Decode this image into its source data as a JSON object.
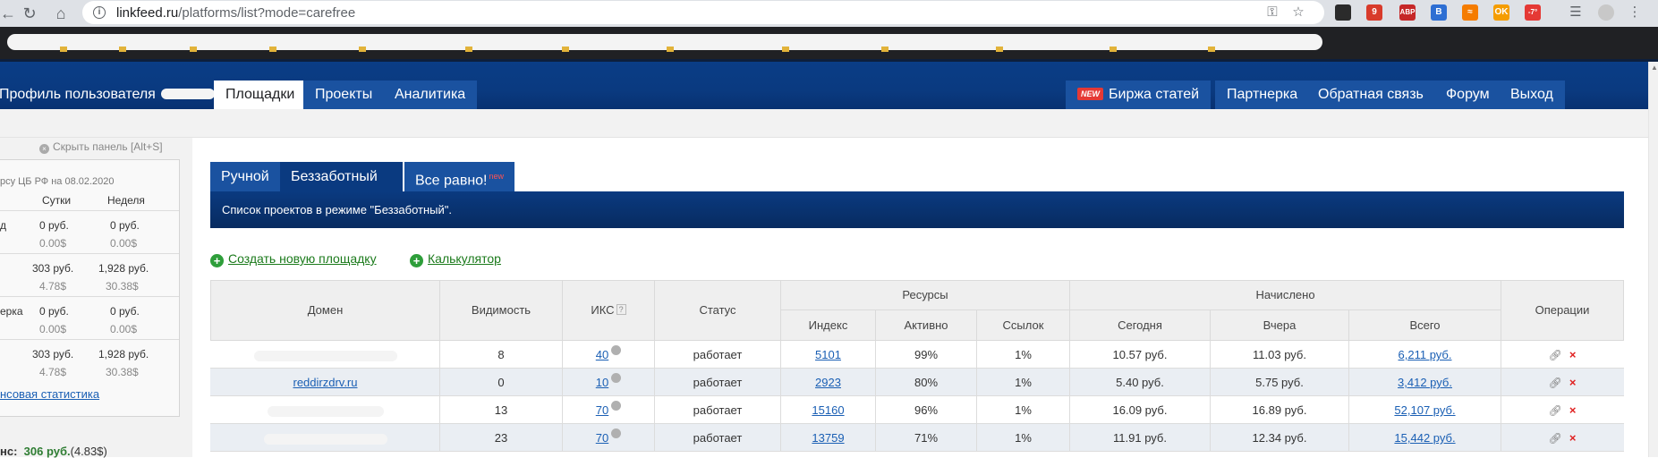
{
  "browser": {
    "url_host": "linkfeed.ru",
    "url_path": "/platforms/list?mode=carefree",
    "back_icon": "arrow-left-icon",
    "reload_icon": "reload-icon",
    "home_icon": "home-icon",
    "key_icon": "key-icon",
    "star_icon": "star-icon",
    "extensions": [
      {
        "label": "",
        "color": "#2b2b2b"
      },
      {
        "label": "9",
        "color": "#d83b2b"
      },
      {
        "label": "ABP",
        "color": "#c62828"
      },
      {
        "label": "B",
        "color": "#2e6fd3"
      },
      {
        "label": "",
        "color": "#f57c00"
      },
      {
        "label": "OK",
        "color": "#f59d00"
      },
      {
        "label": "-7°",
        "color": "#e53935"
      }
    ]
  },
  "nav": {
    "profile": "Профиль пользователя",
    "platforms": "Площадки",
    "projects": "Проекты",
    "analytics": "Аналитика",
    "new_badge": "NEW",
    "articles": "Биржа статей",
    "partners": "Партнерка",
    "feedback": "Обратная связь",
    "forum": "Форум",
    "logout": "Выход"
  },
  "sidebar": {
    "hide_panel": "Скрыть панель [Alt+S]",
    "rate_caption": "рсу ЦБ РФ на 08.02.2020",
    "col_day": "Сутки",
    "col_week": "Неделя",
    "rows": [
      {
        "label": "д",
        "day_rub": "0 руб.",
        "week_rub": "0 руб.",
        "day_usd": "0.00$",
        "week_usd": "0.00$"
      },
      {
        "label": "",
        "day_rub": "303 руб.",
        "week_rub": "1,928 руб.",
        "day_usd": "4.78$",
        "week_usd": "30.38$"
      },
      {
        "label": "ерка",
        "day_rub": "0 руб.",
        "week_rub": "0 руб.",
        "day_usd": "0.00$",
        "week_usd": "0.00$"
      },
      {
        "label": "",
        "day_rub": "303 руб.",
        "week_rub": "1,928 руб.",
        "day_usd": "4.78$",
        "week_usd": "30.38$"
      }
    ],
    "stats_link": "нсовая статистика",
    "balance_label": "нс:",
    "balance_rub": "306 руб.",
    "balance_usd": "(4.83$)"
  },
  "tabs": {
    "manual": "Ручной",
    "carefree": "Беззаботный",
    "any": "Все равно!",
    "any_badge": "new"
  },
  "banner": "Список проектов в режиме \"Беззаботный\".",
  "actions": {
    "create": "Создать новую площадку",
    "calculator": "Калькулятор"
  },
  "table": {
    "headers": {
      "domain": "Домен",
      "visibility": "Видимость",
      "iks": "ИКС",
      "iks_hint": "?",
      "status": "Статус",
      "resources": "Ресурсы",
      "index": "Индекс",
      "active": "Активно",
      "links": "Ссылок",
      "accrued": "Начислено",
      "today": "Сегодня",
      "yesterday": "Вчера",
      "total": "Всего",
      "ops": "Операции"
    },
    "rows": [
      {
        "domain": "",
        "visibility": "8",
        "iks": "40",
        "status": "работает",
        "index": "5101",
        "active": "99%",
        "links": "1%",
        "today": "10.57 руб.",
        "yesterday": "11.03 руб.",
        "total": "6,211 руб."
      },
      {
        "domain": "reddirzdrv.ru",
        "visibility": "0",
        "iks": "10",
        "status": "работает",
        "index": "2923",
        "active": "80%",
        "links": "1%",
        "today": "5.40 руб.",
        "yesterday": "5.75 руб.",
        "total": "3,412 руб."
      },
      {
        "domain": "",
        "visibility": "13",
        "iks": "70",
        "status": "работает",
        "index": "15160",
        "active": "96%",
        "links": "1%",
        "today": "16.09 руб.",
        "yesterday": "16.89 руб.",
        "total": "52,107 руб."
      },
      {
        "domain": "",
        "visibility": "23",
        "iks": "70",
        "status": "работает",
        "index": "13759",
        "active": "71%",
        "links": "1%",
        "today": "11.91 руб.",
        "yesterday": "12.34 руб.",
        "total": "15,442 руб."
      }
    ],
    "op_link_icon": "link-icon",
    "op_delete_icon": "delete-icon"
  }
}
